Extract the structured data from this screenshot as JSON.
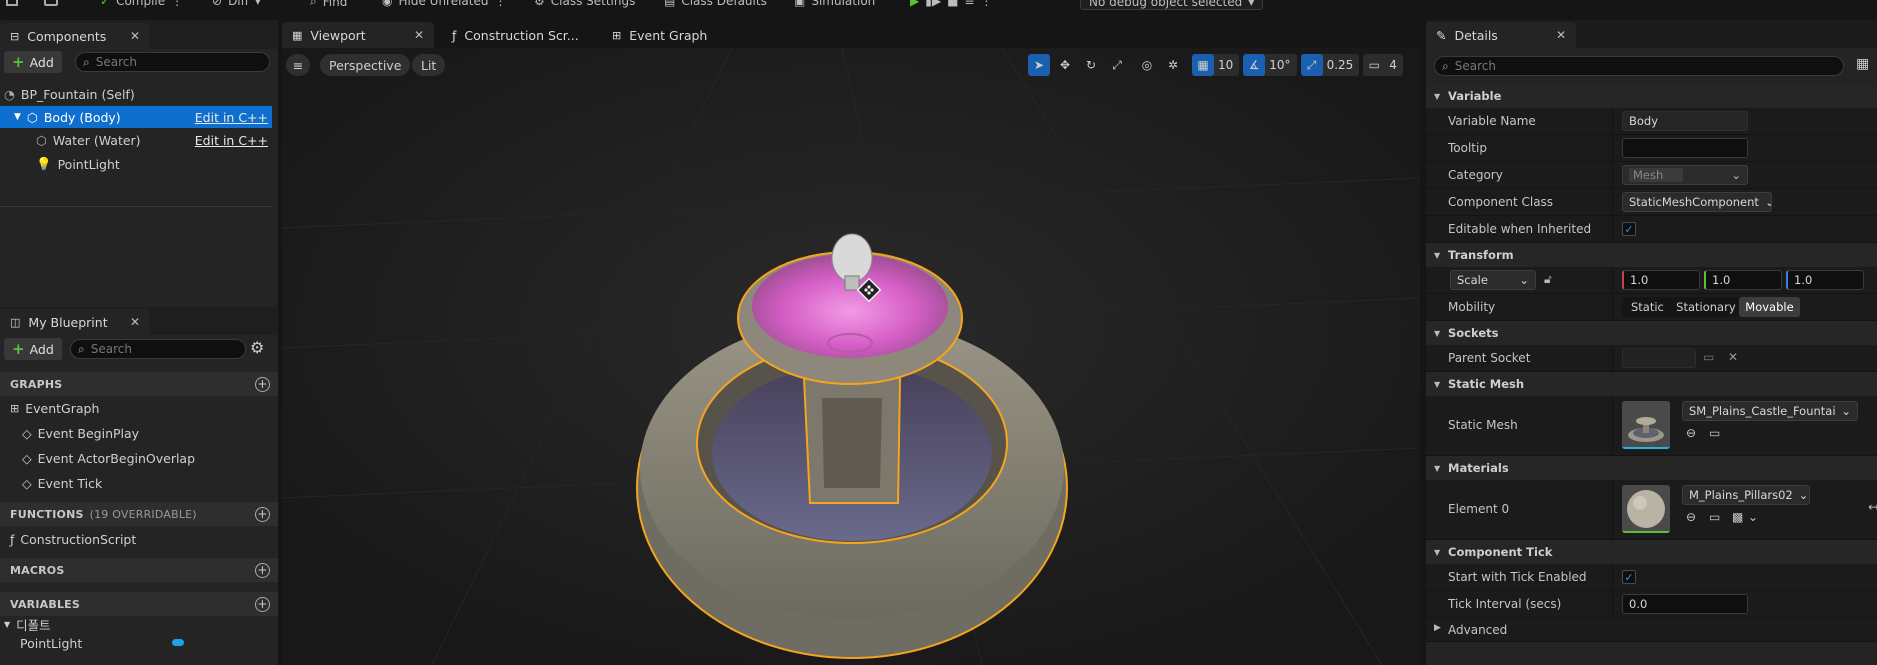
{
  "toolbar": {
    "compile": "Compile",
    "diff": "Diff",
    "find": "Find",
    "hide_unrelated": "Hide Unrelated",
    "class_settings": "Class Settings",
    "class_defaults": "Class Defaults",
    "simulation": "Simulation",
    "debug_object": "No debug object selected"
  },
  "components": {
    "tab_title": "Components",
    "add_label": "Add",
    "search_placeholder": "Search",
    "items": [
      {
        "label": "BP_Fountain (Self)"
      },
      {
        "label": "Body (Body)",
        "action": "Edit in C++"
      },
      {
        "label": "Water (Water)",
        "action": "Edit in C++"
      },
      {
        "label": "PointLight"
      }
    ]
  },
  "my_blueprint": {
    "tab_title": "My Blueprint",
    "add_label": "Add",
    "search_placeholder": "Search",
    "graphs_header": "GRAPHS",
    "event_graph": "EventGraph",
    "events": [
      "Event BeginPlay",
      "Event ActorBeginOverlap",
      "Event Tick"
    ],
    "functions_header": "FUNCTIONS",
    "functions_note": "(19 OVERRIDABLE)",
    "construction_script": "ConstructionScript",
    "macros_header": "MACROS",
    "variables_header": "VARIABLES",
    "variable_category": "디폴트",
    "variable_name": "PointLight",
    "variable_color": "#1aa3e8"
  },
  "editor_tabs": {
    "viewport": "Viewport",
    "construction_script": "Construction Scr...",
    "event_graph": "Event Graph"
  },
  "viewport": {
    "perspective": "Perspective",
    "lit": "Lit",
    "grid_value": "10",
    "rotation_value": "10°",
    "scale_value": "0.25",
    "camera_speed": "4"
  },
  "details": {
    "tab_title": "Details",
    "search_placeholder": "Search",
    "variable_section": "Variable",
    "variable_name_label": "Variable Name",
    "variable_name_value": "Body",
    "tooltip_label": "Tooltip",
    "tooltip_value": "",
    "category_label": "Category",
    "category_value": "Mesh",
    "component_class_label": "Component Class",
    "component_class_value": "StaticMeshComponent",
    "editable_label": "Editable when Inherited",
    "transform_section": "Transform",
    "scale_mode": "Scale",
    "scale_x": "1.0",
    "scale_y": "1.0",
    "scale_z": "1.0",
    "mobility_label": "Mobility",
    "mobility_options": [
      "Static",
      "Stationary",
      "Movable"
    ],
    "sockets_section": "Sockets",
    "parent_socket_label": "Parent Socket",
    "static_mesh_section": "Static Mesh",
    "static_mesh_label": "Static Mesh",
    "static_mesh_value": "SM_Plains_Castle_Fountain_",
    "materials_section": "Materials",
    "element_label": "Element 0",
    "material_value": "M_Plains_Pillars02",
    "component_tick_section": "Component Tick",
    "tick_enabled_label": "Start with Tick Enabled",
    "tick_interval_label": "Tick Interval (secs)",
    "tick_interval_value": "0.0",
    "advanced_label": "Advanced"
  },
  "colors": {
    "selection": "#0e6fce",
    "accent_blue": "#1a5fb0",
    "add_green": "#5bc236",
    "selection_outline": "#f4a51c",
    "water_pink": "#e070d0"
  }
}
